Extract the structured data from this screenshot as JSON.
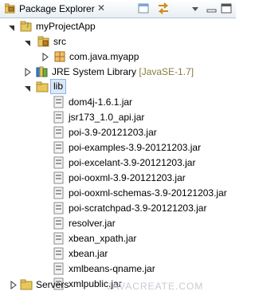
{
  "view": {
    "title": "Package Explorer",
    "close_symbol": "✕",
    "toolbar": [
      "minimize-icon",
      "link-with-editor-icon",
      "view-menu-icon"
    ]
  },
  "tree": {
    "project": "myProjectApp",
    "src": "src",
    "package": "com.java.myapp",
    "jre_name": "JRE System Library",
    "jre_version": "[JavaSE-1.7]",
    "lib": "lib",
    "jars": [
      "dom4j-1.6.1.jar",
      "jsr173_1.0_api.jar",
      "poi-3.9-20121203.jar",
      "poi-examples-3.9-20121203.jar",
      "poi-excelant-3.9-20121203.jar",
      "poi-ooxml-3.9-20121203.jar",
      "poi-ooxml-schemas-3.9-20121203.jar",
      "poi-scratchpad-3.9-20121203.jar",
      "resolver.jar",
      "xbean_xpath.jar",
      "xbean.jar",
      "xmlbeans-qname.jar",
      "xmlpublic.jar"
    ],
    "servers": "Servers"
  },
  "watermark": "JAVACREATE.COM",
  "colors": {
    "selection": "#dbe8fb",
    "folder": "#e8c85a",
    "package": "#c07b2a",
    "jar": "#8a8a8a"
  }
}
